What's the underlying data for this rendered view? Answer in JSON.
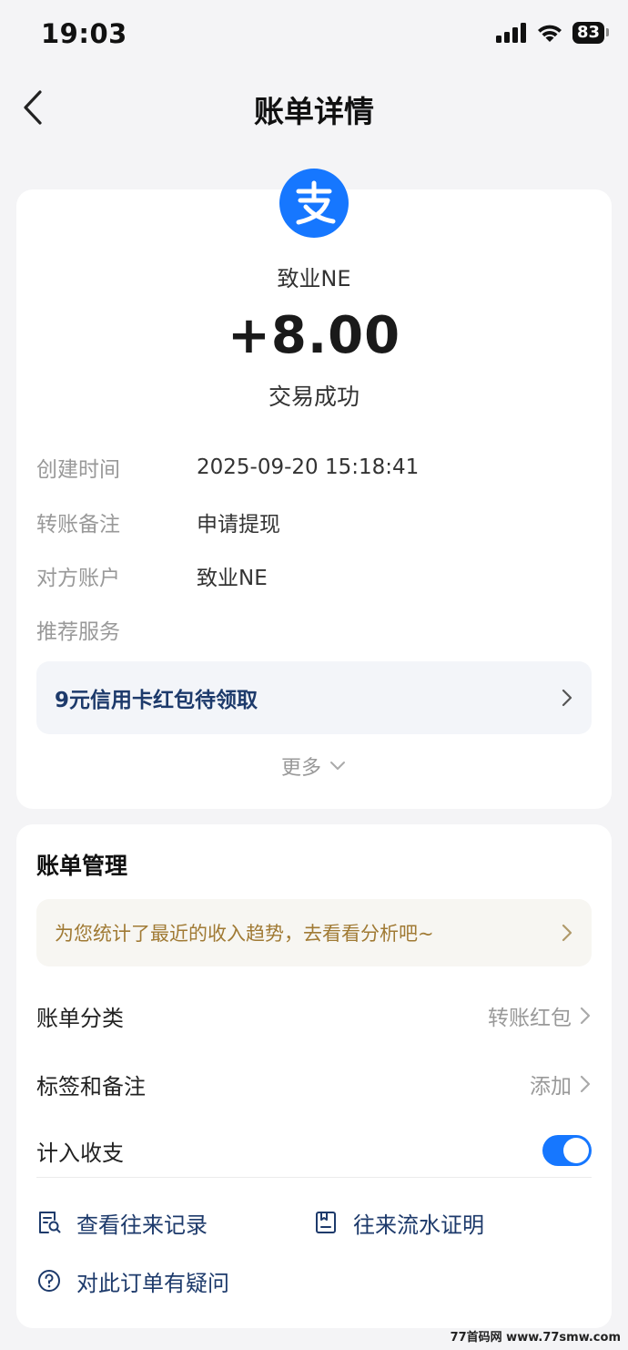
{
  "status_bar": {
    "time": "19:03",
    "battery": "83"
  },
  "nav": {
    "title": "账单详情"
  },
  "bill": {
    "payee": "致业NE",
    "amount": "+8.00",
    "status": "交易成功",
    "details": [
      {
        "label": "创建时间",
        "value": "2025-09-20 15:18:41"
      },
      {
        "label": "转账备注",
        "value": "申请提现"
      },
      {
        "label": "对方账户",
        "value": "致业NE"
      },
      {
        "label": "推荐服务",
        "value": ""
      }
    ],
    "promo": "9元信用卡红包待领取",
    "more": "更多"
  },
  "management": {
    "title": "账单管理",
    "insight": "为您统计了最近的收入趋势，去看看分析吧~",
    "category": {
      "label": "账单分类",
      "value": "转账红包"
    },
    "tags": {
      "label": "标签和备注",
      "value": "添加"
    },
    "include": {
      "label": "计入收支",
      "on": true
    },
    "links": {
      "records": "查看往来记录",
      "proof": "往来流水证明",
      "question": "对此订单有疑问"
    }
  },
  "watermark": "77首码网  www.77smw.com",
  "colors": {
    "accent": "#1677ff",
    "link": "#1d3a6b",
    "insight": "#a07a34"
  }
}
